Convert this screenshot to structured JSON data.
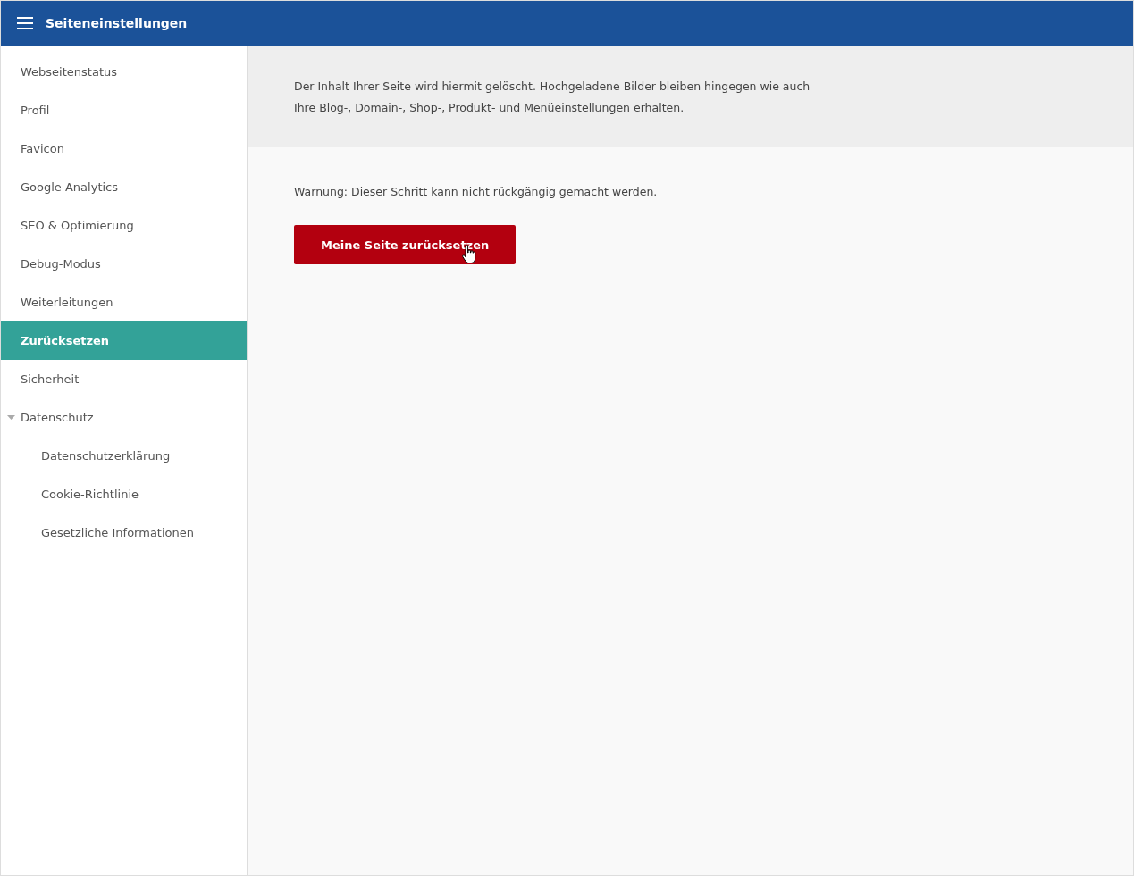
{
  "header": {
    "title": "Seiteneinstellungen"
  },
  "sidebar": {
    "items": [
      {
        "label": "Webseitenstatus",
        "selected": false
      },
      {
        "label": "Profil",
        "selected": false
      },
      {
        "label": "Favicon",
        "selected": false
      },
      {
        "label": "Google Analytics",
        "selected": false
      },
      {
        "label": "SEO & Optimierung",
        "selected": false
      },
      {
        "label": "Debug-Modus",
        "selected": false
      },
      {
        "label": "Weiterleitungen",
        "selected": false
      },
      {
        "label": "Zurücksetzen",
        "selected": true
      },
      {
        "label": "Sicherheit",
        "selected": false
      },
      {
        "label": "Datenschutz",
        "selected": false,
        "expanded": true,
        "children": [
          {
            "label": "Datenschutzerklärung",
            "selected": false
          },
          {
            "label": "Cookie-Richtlinie",
            "selected": false
          },
          {
            "label": "Gesetzliche Informationen",
            "selected": false
          }
        ]
      }
    ]
  },
  "content": {
    "info": "Der Inhalt Ihrer Seite wird hiermit gelöscht. Hochgeladene Bilder bleiben hingegen wie auch Ihre Blog-, Domain-, Shop-, Produkt- und Menüeinstellungen erhalten.",
    "warning": "Warnung: Dieser Schritt kann nicht rückgängig gemacht werden.",
    "button": "Meine Seite zurücksetzen"
  }
}
